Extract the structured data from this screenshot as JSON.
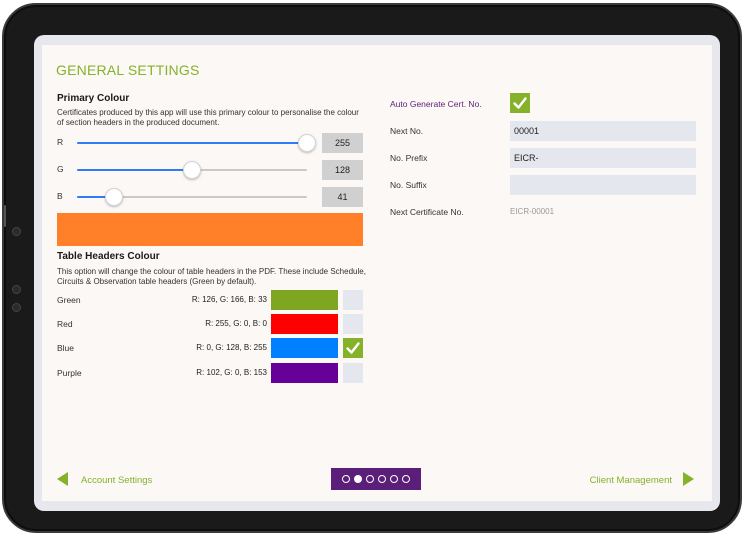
{
  "page": {
    "title": "GENERAL SETTINGS"
  },
  "primary_colour": {
    "heading": "Primary Colour",
    "description": "Certificates produced by this app will use this primary colour to personalise the colour of section headers in the produced document.",
    "channels": [
      {
        "label": "R",
        "value": "255",
        "fraction": 1.0
      },
      {
        "label": "G",
        "value": "128",
        "fraction": 0.502
      },
      {
        "label": "B",
        "value": "41",
        "fraction": 0.161
      }
    ],
    "preview_color": "#ff8029"
  },
  "table_headers": {
    "heading": "Table Headers Colour",
    "description": "This option will change the colour of table headers in the PDF. These include Schedule, Circuits & Observation table headers (Green by default).",
    "options": [
      {
        "name": "Green",
        "rgb": "R: 126, G: 166, B: 33",
        "color": "#7ea621",
        "selected": false
      },
      {
        "name": "Red",
        "rgb": "R: 255, G: 0, B: 0",
        "color": "#ff0000",
        "selected": false
      },
      {
        "name": "Blue",
        "rgb": "R: 0, G: 128, B: 255",
        "color": "#0080ff",
        "selected": true
      },
      {
        "name": "Purple",
        "rgb": "R: 102, G: 0, B: 153",
        "color": "#660099",
        "selected": false
      }
    ]
  },
  "certificate": {
    "auto_generate_label": "Auto Generate Cert. No.",
    "auto_generate_checked": true,
    "next_no_label": "Next No.",
    "next_no_value": "00001",
    "prefix_label": "No. Prefix",
    "prefix_value": "EICR-",
    "suffix_label": "No. Suffix",
    "suffix_value": "",
    "next_cert_label": "Next Certificate No.",
    "next_cert_value": "EICR-00001"
  },
  "footer": {
    "back_label": "Account Settings",
    "forward_label": "Client Management",
    "page_count": 6,
    "current_page": 2
  },
  "colors": {
    "accent_green": "#85b22a",
    "pager_purple": "#5c1f79",
    "link_purple": "#5c1f79"
  }
}
